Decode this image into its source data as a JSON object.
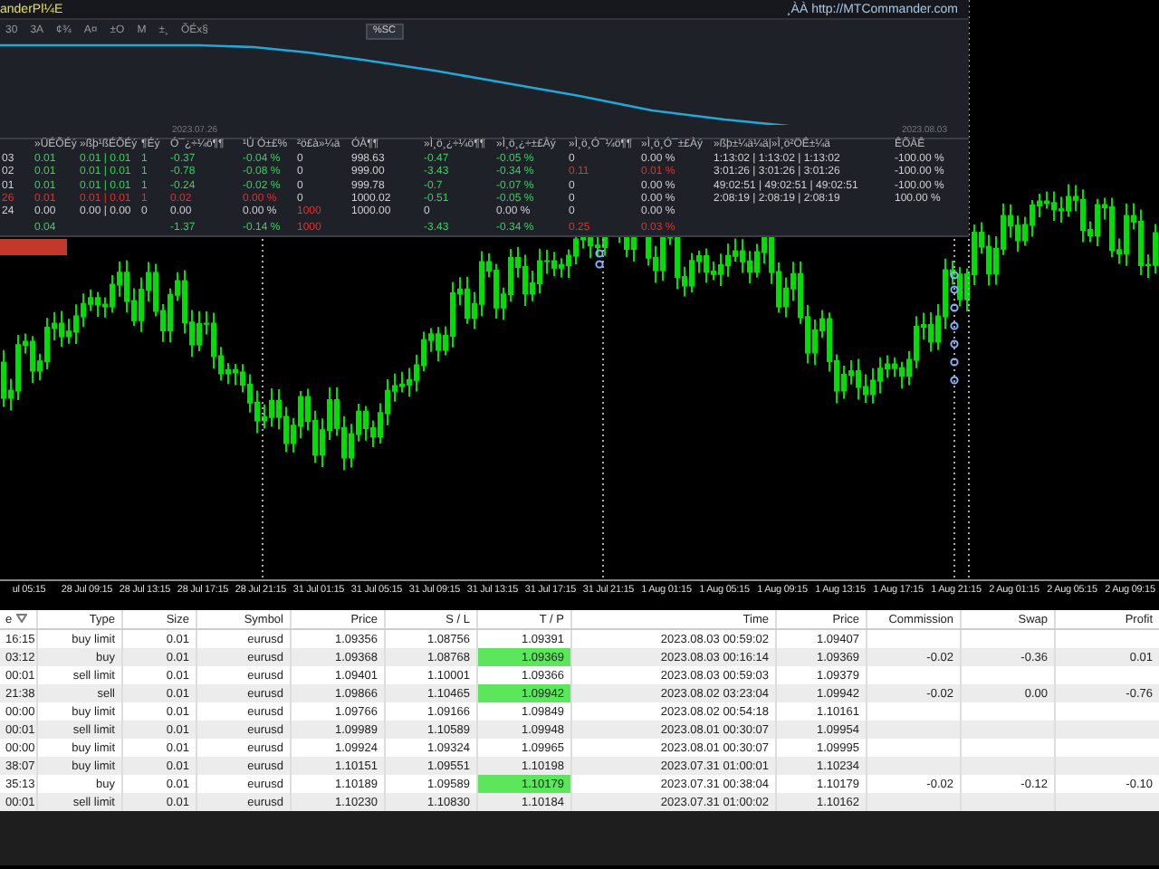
{
  "chart": {
    "time_axis": [
      "ul 05:15",
      "28 Jul 09:15",
      "28 Jul 13:15",
      "28 Jul 17:15",
      "28 Jul 21:15",
      "31 Jul 01:15",
      "31 Jul 05:15",
      "31 Jul 09:15",
      "31 Jul 13:15",
      "31 Jul 17:15",
      "31 Jul 21:15",
      "1 Aug 01:15",
      "1 Aug 05:15",
      "1 Aug 09:15",
      "1 Aug 13:15",
      "1 Aug 17:15",
      "1 Aug 21:15",
      "2 Aug 01:15",
      "2 Aug 05:15",
      "2 Aug 09:15"
    ]
  },
  "panel": {
    "title": "anderPl¼E",
    "link": "¸ÀÀ http://MTCommander.com",
    "toolbar": [
      "30",
      "3A",
      "¢¾",
      "A¤",
      "±O",
      "M",
      "±¸",
      "ÕÉx§"
    ],
    "toolbar_button": "%SC",
    "curve_dates": [
      "2023.07.26",
      "2023.08.03"
    ],
    "columns": [
      "»ÜÉÕÉý",
      "»ßþ¹ßÉÕÉý",
      "¶Éý",
      "Ó¯¿÷¼ö¶¶",
      "¹Ú Ó±£%",
      "²ö£à»¼ä",
      "ÓÀ¶¶",
      "»Ì¸ö¸¿÷¼ö¶¶",
      "»Ì¸ö¸¿÷±£Àý",
      "»Ì¸ö¸Ó¯¼ö¶¶",
      "»Ì¸ö¸Ó¯±£Àý",
      "»ßþ±¼ä¼ä|»Ì¸ö²ÖÊ±¼ä",
      "ÊÕÀÊ"
    ],
    "rows": [
      {
        "label": {
          "text": "03"
        },
        "cells": [
          {
            "text": "0.01",
            "color": "#3ad15a"
          },
          {
            "text": "0.01 | 0.01",
            "color": "#3ad15a"
          },
          {
            "text": "1",
            "color": "#3ad15a"
          },
          {
            "text": "-0.37",
            "color": "#3ad15a"
          },
          {
            "text": "-0.04 %",
            "color": "#3ad15a"
          },
          {
            "text": "0"
          },
          {
            "text": "998.63"
          },
          {
            "text": "-0.47",
            "color": "#3ad15a"
          },
          {
            "text": "-0.05 %",
            "color": "#3ad15a"
          },
          {
            "text": "0"
          },
          {
            "text": "0.00 %"
          },
          {
            "text": "1:13:02 | 1:13:02 | 1:13:02"
          },
          {
            "text": "-100.00 %"
          }
        ]
      },
      {
        "label": {
          "text": "02"
        },
        "cells": [
          {
            "text": "0.01",
            "color": "#3ad15a"
          },
          {
            "text": "0.01 | 0.01",
            "color": "#3ad15a"
          },
          {
            "text": "1",
            "color": "#3ad15a"
          },
          {
            "text": "-0.78",
            "color": "#3ad15a"
          },
          {
            "text": "-0.08 %",
            "color": "#3ad15a"
          },
          {
            "text": "0"
          },
          {
            "text": "999.00"
          },
          {
            "text": "-3.43",
            "color": "#3ad15a"
          },
          {
            "text": "-0.34 %",
            "color": "#3ad15a"
          },
          {
            "text": "0.11",
            "color": "#e5302c"
          },
          {
            "text": "0.01 %",
            "color": "#e5302c"
          },
          {
            "text": "3:01:26 | 3:01:26 | 3:01:26"
          },
          {
            "text": "-100.00 %"
          }
        ]
      },
      {
        "label": {
          "text": "01"
        },
        "cells": [
          {
            "text": "0.01",
            "color": "#3ad15a"
          },
          {
            "text": "0.01 | 0.01",
            "color": "#3ad15a"
          },
          {
            "text": "1",
            "color": "#3ad15a"
          },
          {
            "text": "-0.24",
            "color": "#3ad15a"
          },
          {
            "text": "-0.02 %",
            "color": "#3ad15a"
          },
          {
            "text": "0"
          },
          {
            "text": "999.78"
          },
          {
            "text": "-0.7",
            "color": "#3ad15a"
          },
          {
            "text": "-0.07 %",
            "color": "#3ad15a"
          },
          {
            "text": "0"
          },
          {
            "text": "0.00 %"
          },
          {
            "text": "49:02:51 | 49:02:51 | 49:02:51"
          },
          {
            "text": "-100.00 %"
          }
        ]
      },
      {
        "label": {
          "text": "26",
          "color": "#e5302c"
        },
        "cells": [
          {
            "text": "0.01",
            "color": "#e5302c"
          },
          {
            "text": "0.01 | 0.01",
            "color": "#e5302c"
          },
          {
            "text": "1",
            "color": "#e5302c"
          },
          {
            "text": "0.02",
            "color": "#e5302c"
          },
          {
            "text": "0.00 %",
            "color": "#e5302c"
          },
          {
            "text": "0"
          },
          {
            "text": "1000.02"
          },
          {
            "text": "-0.51",
            "color": "#3ad15a"
          },
          {
            "text": "-0.05 %",
            "color": "#3ad15a"
          },
          {
            "text": "0"
          },
          {
            "text": "0.00 %"
          },
          {
            "text": "2:08:19 | 2:08:19 | 2:08:19"
          },
          {
            "text": "100.00 %"
          }
        ]
      },
      {
        "label": {
          "text": "24"
        },
        "cells": [
          {
            "text": "0.00"
          },
          {
            "text": "0.00 | 0.00"
          },
          {
            "text": "0"
          },
          {
            "text": "0.00"
          },
          {
            "text": "0.00 %"
          },
          {
            "text": "1000",
            "color": "#e5302c"
          },
          {
            "text": "1000.00"
          },
          {
            "text": "0"
          },
          {
            "text": "0.00 %"
          },
          {
            "text": "0"
          },
          {
            "text": "0.00 %"
          },
          null,
          null
        ]
      }
    ],
    "total": {
      "cells": [
        {
          "text": "0.04",
          "color": "#3ad15a"
        },
        null,
        null,
        {
          "text": "-1.37",
          "color": "#3ad15a"
        },
        {
          "text": "-0.14 %",
          "color": "#3ad15a"
        },
        {
          "text": "1000",
          "color": "#e5302c"
        },
        null,
        {
          "text": "-3.43",
          "color": "#3ad15a"
        },
        {
          "text": "-0.34 %",
          "color": "#3ad15a"
        },
        {
          "text": "0.25",
          "color": "#e5302c"
        },
        {
          "text": "0.03 %",
          "color": "#e5302c"
        },
        null,
        null
      ]
    }
  },
  "orders": {
    "columns": [
      "e",
      "Type",
      "Size",
      "Symbol",
      "Price",
      "S / L",
      "T / P",
      "Time",
      "Price",
      "Commission",
      "Swap",
      "Profit"
    ],
    "rows": [
      {
        "tp_hit": false,
        "cells": [
          "16:15",
          "buy limit",
          "0.01",
          "eurusd",
          "1.09356",
          "1.08756",
          "1.09391",
          "2023.08.03 00:59:02",
          "1.09407",
          null,
          null,
          null
        ]
      },
      {
        "tp_hit": true,
        "cells": [
          "03:12",
          "buy",
          "0.01",
          "eurusd",
          "1.09368",
          "1.08768",
          "1.09369",
          "2023.08.03 00:16:14",
          "1.09369",
          "-0.02",
          "-0.36",
          "0.01"
        ]
      },
      {
        "tp_hit": false,
        "cells": [
          "00:01",
          "sell limit",
          "0.01",
          "eurusd",
          "1.09401",
          "1.10001",
          "1.09366",
          "2023.08.03 00:59:03",
          "1.09379",
          null,
          null,
          null
        ]
      },
      {
        "tp_hit": true,
        "cells": [
          "21:38",
          "sell",
          "0.01",
          "eurusd",
          "1.09866",
          "1.10465",
          "1.09942",
          "2023.08.02 03:23:04",
          "1.09942",
          "-0.02",
          "0.00",
          "-0.76"
        ]
      },
      {
        "tp_hit": false,
        "cells": [
          "00:00",
          "buy limit",
          "0.01",
          "eurusd",
          "1.09766",
          "1.09166",
          "1.09849",
          "2023.08.02 00:54:18",
          "1.10161",
          null,
          null,
          null
        ]
      },
      {
        "tp_hit": false,
        "cells": [
          "00:01",
          "sell limit",
          "0.01",
          "eurusd",
          "1.09989",
          "1.10589",
          "1.09948",
          "2023.08.01 00:30:07",
          "1.09954",
          null,
          null,
          null
        ]
      },
      {
        "tp_hit": false,
        "cells": [
          "00:00",
          "buy limit",
          "0.01",
          "eurusd",
          "1.09924",
          "1.09324",
          "1.09965",
          "2023.08.01 00:30:07",
          "1.09995",
          null,
          null,
          null
        ]
      },
      {
        "tp_hit": false,
        "cells": [
          "38:07",
          "buy limit",
          "0.01",
          "eurusd",
          "1.10151",
          "1.09551",
          "1.10198",
          "2023.07.31 01:00:01",
          "1.10234",
          null,
          null,
          null
        ]
      },
      {
        "tp_hit": true,
        "cells": [
          "35:13",
          "buy",
          "0.01",
          "eurusd",
          "1.10189",
          "1.09589",
          "1.10179",
          "2023.07.31 00:38:04",
          "1.10179",
          "-0.02",
          "-0.12",
          "-0.10"
        ]
      },
      {
        "tp_hit": false,
        "cells": [
          "00:01",
          "sell limit",
          "0.01",
          "eurusd",
          "1.10230",
          "1.10830",
          "1.10184",
          "2023.07.31 01:00:02",
          "1.10162",
          null,
          null,
          null
        ]
      }
    ]
  }
}
